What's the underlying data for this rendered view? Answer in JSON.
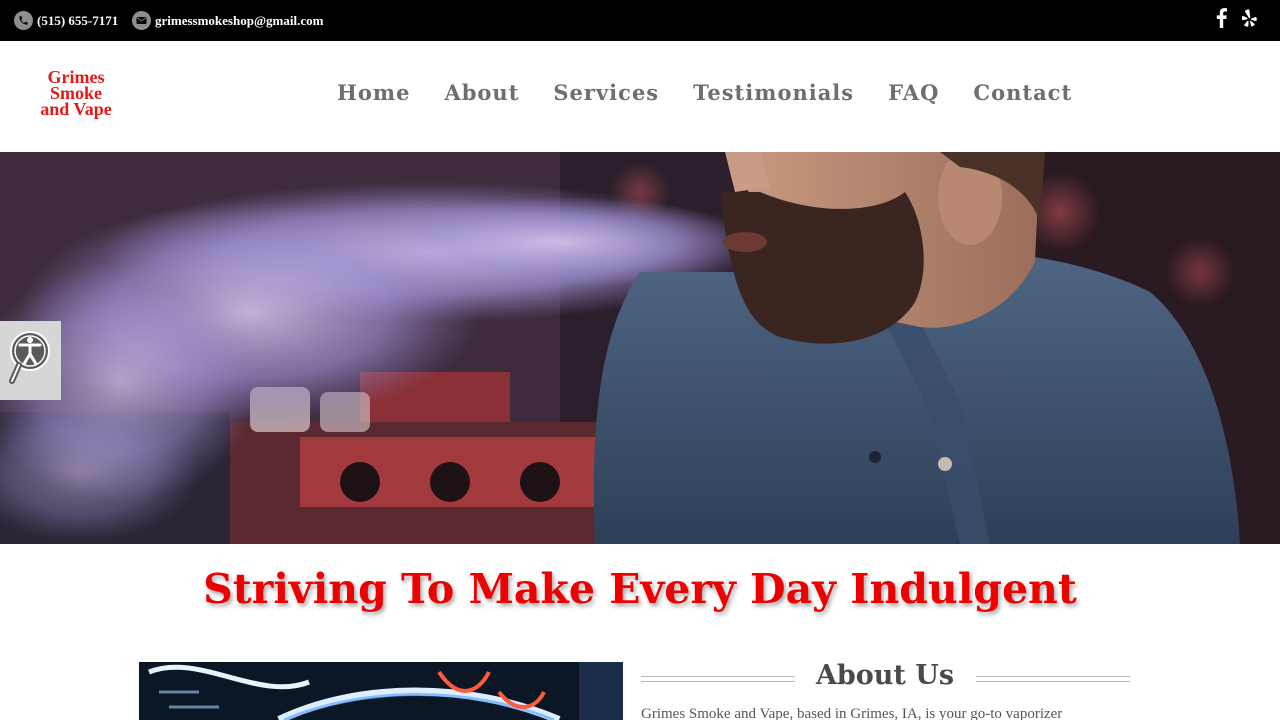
{
  "topbar": {
    "phone": "(515) 655-7171",
    "email": "grimessmokeshop@gmail.com",
    "phone_icon": "phone-icon",
    "email_icon": "envelope-icon",
    "social": [
      {
        "name": "facebook-icon"
      },
      {
        "name": "yelp-icon"
      }
    ]
  },
  "logo": {
    "line1": "Grimes",
    "line2": "Smoke",
    "line3": "and Vape",
    "color": "#e11a1a"
  },
  "nav": {
    "items": [
      {
        "label": "Home"
      },
      {
        "label": "About"
      },
      {
        "label": "Services"
      },
      {
        "label": "Testimonials"
      },
      {
        "label": "FAQ"
      },
      {
        "label": "Contact"
      }
    ]
  },
  "accessibility": {
    "icon": "accessibility-icon"
  },
  "headline": {
    "text": "Striving To Make Every Day Indulgent",
    "color": "#ee0000"
  },
  "about": {
    "title": "About Us",
    "text": "Grimes Smoke and Vape, based in Grimes, IA, is your go-to vaporizer"
  }
}
